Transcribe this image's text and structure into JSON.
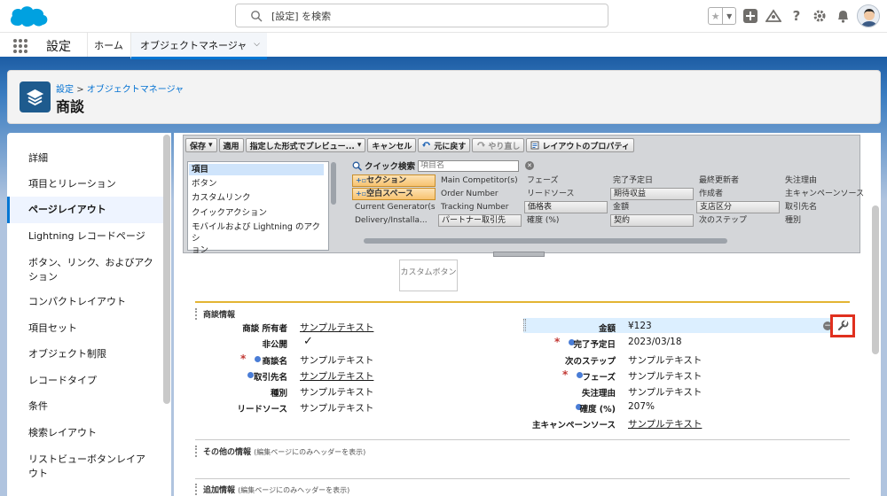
{
  "search": {
    "placeholder": "[設定] を検索"
  },
  "appnav": {
    "app_name": "設定",
    "tabs": [
      "ホーム",
      "オブジェクトマネージャ"
    ]
  },
  "header": {
    "breadcrumb": [
      "設定",
      "オブジェクトマネージャ"
    ],
    "breadcrumb_sep": ">",
    "title": "商談"
  },
  "sidebar": {
    "items": [
      {
        "label": "詳細"
      },
      {
        "label": "項目とリレーション"
      },
      {
        "label": "ページレイアウト",
        "active": true
      },
      {
        "label": "Lightning レコードページ"
      },
      {
        "label": "ボタン、リンク、およびアク\nション"
      },
      {
        "label": "コンパクトレイアウト"
      },
      {
        "label": "項目セット"
      },
      {
        "label": "オブジェクト制限"
      },
      {
        "label": "レコードタイプ"
      },
      {
        "label": "条件"
      },
      {
        "label": "検索レイアウト"
      },
      {
        "label": "リストビューボタンレイア\nウト"
      }
    ]
  },
  "toolbar": {
    "save": "保存",
    "apply": "適用",
    "preview": "指定した形式でプレビュー...",
    "cancel": "キャンセル",
    "undo": "元に戻す",
    "redo": "やり直し",
    "layout_props": "レイアウトのプロパティ"
  },
  "palette": {
    "categories": [
      "項目",
      "ボタン",
      "カスタムリンク",
      "クイックアクション",
      "モバイルおよび Lightning のアクシ\nョン"
    ],
    "quick_find_label": "クイック検索",
    "quick_find_placeholder": "項目名",
    "grid": [
      [
        {
          "t": "セクション",
          "k": "orange"
        },
        {
          "t": "Main Competitor(s)",
          "k": "plain"
        },
        {
          "t": "フェーズ",
          "k": "plain"
        },
        {
          "t": "完了予定日",
          "k": "plain"
        },
        {
          "t": "最終更新者",
          "k": "plain"
        },
        {
          "t": "失注理由",
          "k": "plain"
        }
      ],
      [
        {
          "t": "空白スペース",
          "k": "orange"
        },
        {
          "t": "Order Number",
          "k": "plain"
        },
        {
          "t": "リードソース",
          "k": "plain"
        },
        {
          "t": "期待収益",
          "k": "btn"
        },
        {
          "t": "作成者",
          "k": "plain"
        },
        {
          "t": "主キャンペーンソース",
          "k": "plain"
        }
      ],
      [
        {
          "t": "Current Generator(s)",
          "k": "plain"
        },
        {
          "t": "Tracking Number",
          "k": "plain"
        },
        {
          "t": "価格表",
          "k": "btn"
        },
        {
          "t": "金額",
          "k": "plain"
        },
        {
          "t": "支店区分",
          "k": "btn"
        },
        {
          "t": "取引先名",
          "k": "plain"
        }
      ],
      [
        {
          "t": "Delivery/Installa...",
          "k": "plain"
        },
        {
          "t": "パートナー取引先",
          "k": "btn"
        },
        {
          "t": "確度 (%)",
          "k": "plain"
        },
        {
          "t": "契約",
          "k": "btn"
        },
        {
          "t": "次のステップ",
          "k": "plain"
        },
        {
          "t": "種別",
          "k": "plain"
        }
      ]
    ]
  },
  "canvas": {
    "custom_button": "カスタムボタン",
    "section1": "商談情報",
    "section2": "その他の情報",
    "section2_note": "(編集ページにのみヘッダーを表示)",
    "section3": "追加情報",
    "section3_note": "(編集ページにのみヘッダーを表示)",
    "left_fields": [
      {
        "label": "商談 所有者",
        "value": "サンプルテキスト",
        "link": true,
        "req": false,
        "dot": false
      },
      {
        "label": "非公開",
        "value": "✓",
        "link": false,
        "req": false,
        "dot": false
      },
      {
        "label": "商談名",
        "value": "サンプルテキスト",
        "link": false,
        "req": true,
        "dot": true
      },
      {
        "label": "取引先名",
        "value": "サンプルテキスト",
        "link": true,
        "req": false,
        "dot": true
      },
      {
        "label": "種別",
        "value": "サンプルテキスト",
        "link": false,
        "req": false,
        "dot": false
      },
      {
        "label": "リードソース",
        "value": "サンプルテキスト",
        "link": false,
        "req": false,
        "dot": false
      }
    ],
    "right_fields": [
      {
        "label": "金額",
        "value": "¥123",
        "link": false,
        "req": false,
        "dot": false
      },
      {
        "label": "完了予定日",
        "value": "2023/03/18",
        "link": false,
        "req": true,
        "dot": true
      },
      {
        "label": "次のステップ",
        "value": "サンプルテキスト",
        "link": false,
        "req": false,
        "dot": false
      },
      {
        "label": "フェーズ",
        "value": "サンプルテキスト",
        "link": false,
        "req": true,
        "dot": true
      },
      {
        "label": "失注理由",
        "value": "サンプルテキスト",
        "link": false,
        "req": false,
        "dot": false
      },
      {
        "label": "確度 (%)",
        "value": "207%",
        "link": false,
        "req": false,
        "dot": true
      },
      {
        "label": "主キャンペーンソース",
        "value": "サンプルテキスト",
        "link": true,
        "req": false,
        "dot": false
      }
    ]
  },
  "colors": {
    "brand": "#0176d3",
    "required": "#c23934",
    "highlight": "#e0301e",
    "section_line": "#e3b533"
  }
}
